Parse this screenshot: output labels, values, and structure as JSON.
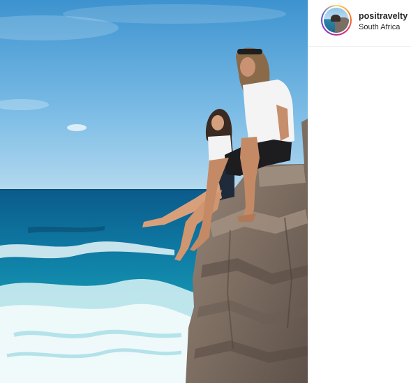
{
  "post": {
    "image_alt": "Two people sitting on a sea cliff edge above a turquoise ocean",
    "author": {
      "username": "positravelty",
      "location": "South Africa"
    }
  },
  "colors": {
    "story_ring": [
      "#feda75",
      "#fa7e1e",
      "#d62976",
      "#962fbf",
      "#4f5bd5"
    ],
    "text": "#262626",
    "divider": "#efefef"
  }
}
